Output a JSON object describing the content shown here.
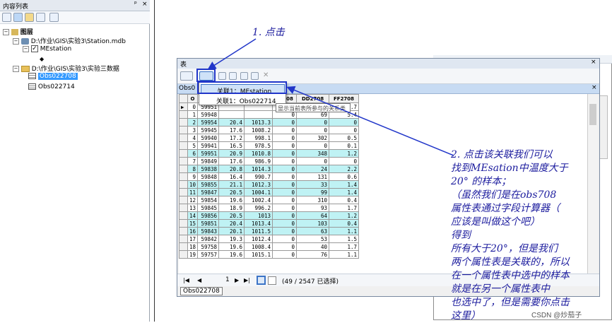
{
  "toc": {
    "title": "内容列表",
    "layers_label": "图层",
    "mdb_path": "D:\\作业\\GIS\\实验3\\Station.mdb",
    "mestation": "MEstation",
    "folder_path": "D:\\作业\\GIS\\实验3\\实验三数据",
    "obs1": "Obs022708",
    "obs2": "Obs022714",
    "pin_glyph": "ᵖ",
    "close_glyph": "×"
  },
  "table_window": {
    "title": "表",
    "tab_label": "Obs0",
    "bottom_tab": "Obs022708",
    "nav_page": "1",
    "selection_info": "(49 / 2547 已选择)",
    "close_glyph": "×"
  },
  "dropdown": {
    "item1": "关联1：MEstation",
    "item2": "关联1：Obs022714",
    "tooltip": "显示当前表所参与的关系类"
  },
  "grid": {
    "columns": [
      "O",
      "",
      "",
      "P2708",
      "P2708",
      "DD2708",
      "FF2708"
    ],
    "rows": [
      {
        "hl": false,
        "cur": true,
        "c": [
          "0",
          "59951",
          "",
          "",
          "0",
          "73",
          "3.7"
        ]
      },
      {
        "hl": false,
        "c": [
          "1",
          "59948",
          "",
          "",
          "0",
          "69",
          "5.4"
        ]
      },
      {
        "hl": true,
        "c": [
          "2",
          "59954",
          "20.4",
          "1013.3",
          "0",
          "0",
          "0"
        ]
      },
      {
        "hl": false,
        "c": [
          "3",
          "59945",
          "17.6",
          "1008.2",
          "0",
          "0",
          "0"
        ]
      },
      {
        "hl": false,
        "c": [
          "4",
          "59940",
          "17.2",
          "998.1",
          "0",
          "302",
          "0.5"
        ]
      },
      {
        "hl": false,
        "c": [
          "5",
          "59941",
          "16.5",
          "978.5",
          "0",
          "0",
          "0.1"
        ]
      },
      {
        "hl": true,
        "c": [
          "6",
          "59951",
          "20.9",
          "1010.8",
          "0",
          "348",
          "1.2"
        ]
      },
      {
        "hl": false,
        "c": [
          "7",
          "59849",
          "17.6",
          "986.9",
          "0",
          "0",
          "0"
        ]
      },
      {
        "hl": true,
        "c": [
          "8",
          "59838",
          "20.8",
          "1014.3",
          "0",
          "24",
          "2.2"
        ]
      },
      {
        "hl": false,
        "c": [
          "9",
          "59848",
          "16.4",
          "990.7",
          "0",
          "131",
          "0.6"
        ]
      },
      {
        "hl": true,
        "c": [
          "10",
          "59855",
          "21.1",
          "1012.3",
          "0",
          "33",
          "1.4"
        ]
      },
      {
        "hl": true,
        "c": [
          "11",
          "59847",
          "20.5",
          "1004.1",
          "0",
          "99",
          "1.4"
        ]
      },
      {
        "hl": false,
        "c": [
          "12",
          "59854",
          "19.6",
          "1002.4",
          "0",
          "310",
          "0.4"
        ]
      },
      {
        "hl": false,
        "c": [
          "13",
          "59845",
          "18.9",
          "996.2",
          "0",
          "93",
          "1.7"
        ]
      },
      {
        "hl": true,
        "c": [
          "14",
          "59856",
          "20.5",
          "1013",
          "0",
          "64",
          "1.2"
        ]
      },
      {
        "hl": true,
        "c": [
          "15",
          "59851",
          "20.4",
          "1013.4",
          "0",
          "103",
          "0.4"
        ]
      },
      {
        "hl": true,
        "c": [
          "16",
          "59843",
          "20.1",
          "1011.5",
          "0",
          "63",
          "1.1"
        ]
      },
      {
        "hl": false,
        "c": [
          "17",
          "59842",
          "19.3",
          "1012.4",
          "0",
          "53",
          "1.5"
        ]
      },
      {
        "hl": false,
        "c": [
          "18",
          "59758",
          "19.6",
          "1008.4",
          "0",
          "40",
          "1.7"
        ]
      },
      {
        "hl": false,
        "c": [
          "19",
          "59757",
          "19.6",
          "1015.1",
          "0",
          "76",
          "1.1"
        ]
      }
    ]
  },
  "annotations": {
    "step1": "1. 点击",
    "step2_lines": [
      "2. 点击该关联我们可以",
      "找到MEsation中温度大于",
      "20° 的样本；",
      "（虽然我们是在obs708",
      "属性表通过字段计算器（",
      "应该是叫做这个吧）",
      "得到",
      "所有大于20°，但是我们",
      "两个属性表是关联的，所以",
      "在一个属性表中选中的样本",
      "就是在另一个属性表中",
      "也选中了，但是需要你点击",
      "这里）"
    ],
    "watermark": "CSDN @炒茄子"
  },
  "colors": {
    "highlight_row": "#bff2f4",
    "annotation": "#1c1c9e",
    "selection": "#3399ff"
  }
}
